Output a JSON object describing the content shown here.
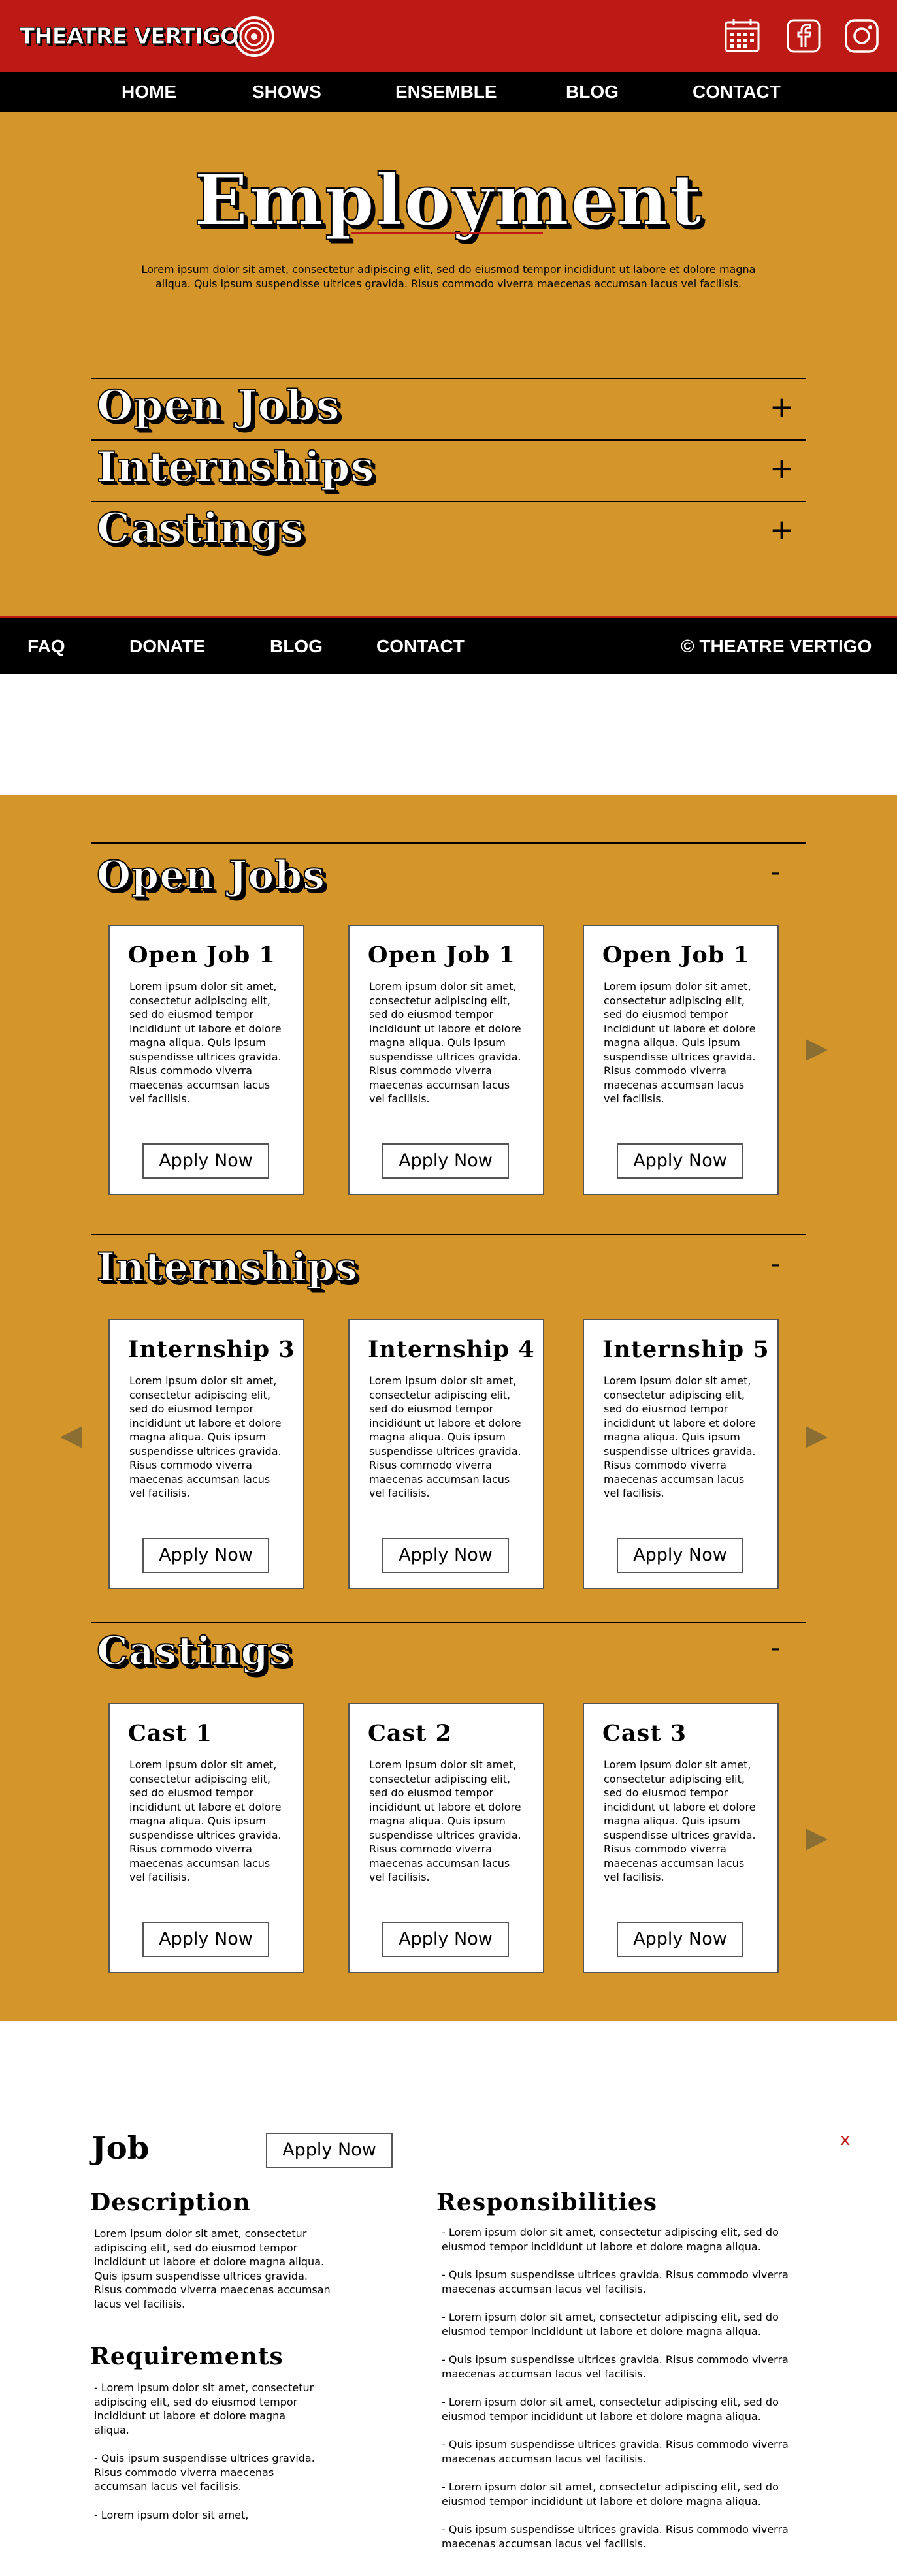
{
  "brand": {
    "name": "THEATRE VERTIGO",
    "colors": {
      "red": "#bd1a15",
      "gold": "#d4952a",
      "black": "#000000",
      "arrow": "#8b6f32"
    }
  },
  "header": {
    "icons": [
      "calendar-icon",
      "facebook-icon",
      "instagram-icon"
    ]
  },
  "nav": {
    "items": [
      "HOME",
      "SHOWS",
      "ENSEMBLE",
      "BLOG",
      "CONTACT"
    ]
  },
  "hero": {
    "title": "Employment",
    "text": "Lorem ipsum dolor sit amet, consectetur adipiscing elit, sed do eiusmod tempor incididunt ut labore et dolore magna aliqua. Quis ipsum suspendisse ultrices gravida. Risus commodo viverra maecenas accumsan lacus vel facilisis."
  },
  "accordion": {
    "items": [
      {
        "title": "Open Jobs",
        "toggle": "+"
      },
      {
        "title": "Internships",
        "toggle": "+"
      },
      {
        "title": "Castings",
        "toggle": "+"
      }
    ]
  },
  "footer": {
    "items": [
      "FAQ",
      "DONATE",
      "BLOG",
      "CONTACT"
    ],
    "copyright": "© THEATRE VERTIGO"
  },
  "sections": [
    {
      "title": "Open Jobs",
      "toggle": "-",
      "cards": [
        {
          "title": "Open Job 1",
          "text": "Lorem ipsum dolor sit amet, consectetur adipiscing elit, sed do eiusmod tempor incididunt ut labore et dolore magna aliqua. Quis ipsum suspendisse ultrices gravida. Risus commodo viverra maecenas accumsan lacus vel facilisis.",
          "button": "Apply Now"
        },
        {
          "title": "Open Job 1",
          "text": "Lorem ipsum dolor sit amet, consectetur adipiscing elit, sed do eiusmod tempor incididunt ut labore et dolore magna aliqua. Quis ipsum suspendisse ultrices gravida. Risus commodo viverra maecenas accumsan lacus vel facilisis.",
          "button": "Apply Now"
        },
        {
          "title": "Open Job 1",
          "text": "Lorem ipsum dolor sit amet, consectetur adipiscing elit, sed do eiusmod tempor incididunt ut labore et dolore magna aliqua. Quis ipsum suspendisse ultrices gravida. Risus commodo viverra maecenas accumsan lacus vel facilisis.",
          "button": "Apply Now"
        }
      ]
    },
    {
      "title": "Internships",
      "toggle": "-",
      "cards": [
        {
          "title": "Internship 3",
          "text": "Lorem ipsum dolor sit amet, consectetur adipiscing elit, sed do eiusmod tempor incididunt ut labore et dolore magna aliqua. Quis ipsum suspendisse ultrices gravida. Risus commodo viverra maecenas accumsan lacus vel facilisis.",
          "button": "Apply Now"
        },
        {
          "title": "Internship 4",
          "text": "Lorem ipsum dolor sit amet, consectetur adipiscing elit, sed do eiusmod tempor incididunt ut labore et dolore magna aliqua. Quis ipsum suspendisse ultrices gravida. Risus commodo viverra maecenas accumsan lacus vel facilisis.",
          "button": "Apply Now"
        },
        {
          "title": "Internship 5",
          "text": "Lorem ipsum dolor sit amet, consectetur adipiscing elit, sed do eiusmod tempor incididunt ut labore et dolore magna aliqua. Quis ipsum suspendisse ultrices gravida. Risus commodo viverra maecenas accumsan lacus vel facilisis.",
          "button": "Apply Now"
        }
      ]
    },
    {
      "title": "Castings",
      "toggle": "-",
      "cards": [
        {
          "title": "Cast 1",
          "text": "Lorem ipsum dolor sit amet, consectetur adipiscing elit, sed do eiusmod tempor incididunt ut labore et dolore magna aliqua. Quis ipsum suspendisse ultrices gravida. Risus commodo viverra maecenas accumsan lacus vel facilisis.",
          "button": "Apply Now"
        },
        {
          "title": "Cast 2",
          "text": "Lorem ipsum dolor sit amet, consectetur adipiscing elit, sed do eiusmod tempor incididunt ut labore et dolore magna aliqua. Quis ipsum suspendisse ultrices gravida. Risus commodo viverra maecenas accumsan lacus vel facilisis.",
          "button": "Apply Now"
        },
        {
          "title": "Cast 3",
          "text": "Lorem ipsum dolor sit amet, consectetur adipiscing elit, sed do eiusmod tempor incididunt ut labore et dolore magna aliqua. Quis ipsum suspendisse ultrices gravida. Risus commodo viverra maecenas accumsan lacus vel facilisis.",
          "button": "Apply Now"
        }
      ]
    }
  ],
  "job": {
    "title": "Job",
    "apply": "Apply Now",
    "close": "x",
    "description_heading": "Description",
    "description": "Lorem ipsum dolor sit amet, consectetur adipiscing elit, sed do eiusmod tempor incididunt ut labore et dolore magna aliqua. Quis ipsum suspendisse ultrices gravida. Risus commodo viverra maecenas accumsan lacus vel facilisis.",
    "requirements_heading": "Requirements",
    "requirements": [
      "- Lorem ipsum dolor sit amet, consectetur adipiscing elit, sed do eiusmod tempor incididunt ut labore et dolore magna aliqua.",
      "- Quis ipsum suspendisse ultrices gravida. Risus commodo viverra maecenas accumsan lacus vel facilisis.",
      "- Lorem ipsum dolor sit amet,"
    ],
    "responsibilities_heading": "Responsibilities",
    "responsibilities": [
      "- Lorem ipsum dolor sit amet, consectetur adipiscing elit, sed do eiusmod tempor incididunt ut labore et dolore magna aliqua.",
      "- Quis ipsum suspendisse ultrices gravida. Risus commodo viverra maecenas accumsan lacus vel facilisis.",
      "- Lorem ipsum dolor sit amet, consectetur adipiscing elit, sed do eiusmod tempor incididunt ut labore et dolore magna aliqua.",
      "- Quis ipsum suspendisse ultrices gravida. Risus commodo viverra maecenas accumsan lacus vel facilisis.",
      "- Lorem ipsum dolor sit amet, consectetur adipiscing elit, sed do eiusmod tempor incididunt ut labore et dolore magna aliqua.",
      "- Quis ipsum suspendisse ultrices gravida. Risus commodo viverra maecenas accumsan lacus vel facilisis.",
      "- Lorem ipsum dolor sit amet, consectetur adipiscing elit, sed do eiusmod tempor incididunt ut labore et dolore magna aliqua.",
      "- Quis ipsum suspendisse ultrices gravida. Risus commodo viverra maecenas accumsan lacus vel facilisis."
    ]
  }
}
